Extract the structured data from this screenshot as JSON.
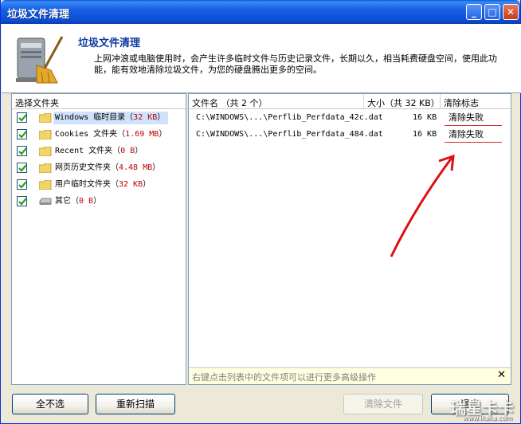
{
  "window": {
    "title": "垃圾文件清理"
  },
  "header": {
    "title": "垃圾文件清理",
    "description": "上网冲浪或电脑使用时，会产生许多临时文件与历史记录文件，长期以久，相当耗费硬盘空间，使用此功能，能有效地清除垃圾文件，为您的硬盘腾出更多的空间。"
  },
  "tree": {
    "header": "选择文件夹",
    "items": [
      {
        "name": "Windows 临时目录",
        "paren_open": "（",
        "size": "32 KB",
        "paren_close": "）",
        "checked": true,
        "selected": true
      },
      {
        "name": "Cookies 文件夹",
        "paren_open": "（",
        "size": "1.69 MB",
        "paren_close": "）",
        "checked": true,
        "selected": false
      },
      {
        "name": "Recent 文件夹",
        "paren_open": "（",
        "size": "0 B",
        "paren_close": "）",
        "checked": true,
        "selected": false
      },
      {
        "name": "网页历史文件夹",
        "paren_open": "（",
        "size": "4.48 MB",
        "paren_close": "）",
        "checked": true,
        "selected": false
      },
      {
        "name": "用户临时文件夹",
        "paren_open": "（",
        "size": "32 KB",
        "paren_close": "）",
        "checked": true,
        "selected": false
      },
      {
        "name": "其它",
        "paren_open": "（",
        "size": "0 B",
        "paren_close": "）",
        "checked": true,
        "selected": false
      }
    ]
  },
  "list": {
    "columns": {
      "filename": "文件名 （共 2 个）",
      "size": "大小（共 32 KB）",
      "status": "清除标志"
    },
    "rows": [
      {
        "filename": "C:\\WINDOWS\\...\\Perflib_Perfdata_42c.dat",
        "size": "16 KB",
        "status": "清除失败"
      },
      {
        "filename": "C:\\WINDOWS\\...\\Perflib_Perfdata_484.dat",
        "size": "16 KB",
        "status": "清除失败"
      }
    ],
    "hint": "右键点击列表中的文件项可以进行更多高级操作",
    "hint_close": "✕"
  },
  "buttons": {
    "deselect_all": "全不选",
    "rescan": "重新扫描",
    "clean_files": "清除文件",
    "exit": "退出"
  },
  "watermark": {
    "text": "瑞星卡卡",
    "url": "www.ikaka.com"
  },
  "colors": {
    "accent": "#0b3a9e",
    "size_red": "#c00000",
    "selection": "#cfe2fb"
  }
}
